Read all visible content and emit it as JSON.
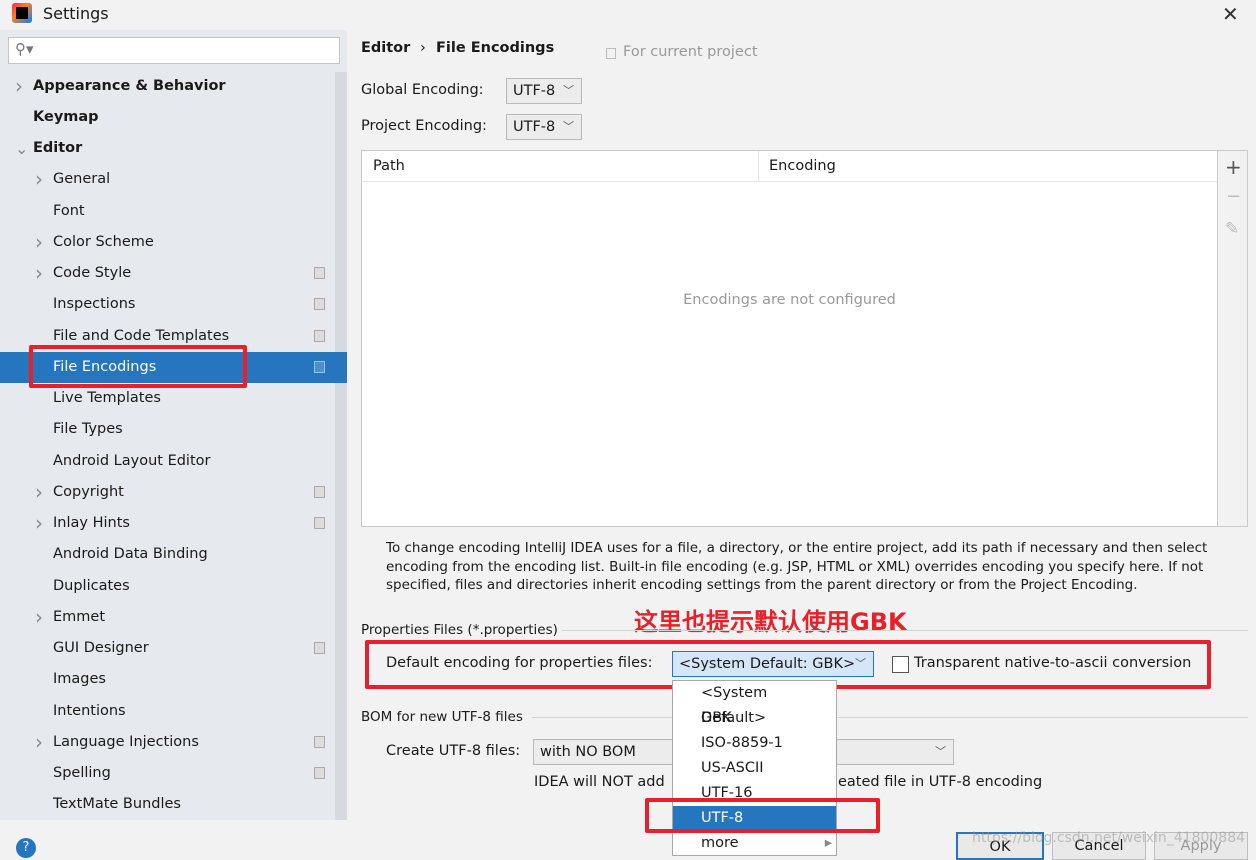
{
  "window": {
    "title": "Settings",
    "close": "✕"
  },
  "search": {
    "placeholder": "",
    "icon": "search-icon"
  },
  "sidebar": {
    "items": [
      {
        "label": "Appearance & Behavior",
        "level": 0,
        "chevron": "right",
        "bold": true,
        "copy": false
      },
      {
        "label": "Keymap",
        "level": 0,
        "chevron": "",
        "bold": true,
        "copy": false
      },
      {
        "label": "Editor",
        "level": 0,
        "chevron": "down",
        "bold": true,
        "copy": false
      },
      {
        "label": "General",
        "level": 1,
        "chevron": "right",
        "copy": false
      },
      {
        "label": "Font",
        "level": 1,
        "chevron": "",
        "copy": false
      },
      {
        "label": "Color Scheme",
        "level": 1,
        "chevron": "right",
        "copy": false
      },
      {
        "label": "Code Style",
        "level": 1,
        "chevron": "right",
        "copy": true
      },
      {
        "label": "Inspections",
        "level": 1,
        "chevron": "",
        "copy": true
      },
      {
        "label": "File and Code Templates",
        "level": 1,
        "chevron": "",
        "copy": true
      },
      {
        "label": "File Encodings",
        "level": 1,
        "chevron": "",
        "copy": true,
        "selected": true
      },
      {
        "label": "Live Templates",
        "level": 1,
        "chevron": "",
        "copy": false
      },
      {
        "label": "File Types",
        "level": 1,
        "chevron": "",
        "copy": false
      },
      {
        "label": "Android Layout Editor",
        "level": 1,
        "chevron": "",
        "copy": false
      },
      {
        "label": "Copyright",
        "level": 1,
        "chevron": "right",
        "copy": true
      },
      {
        "label": "Inlay Hints",
        "level": 1,
        "chevron": "right",
        "copy": true
      },
      {
        "label": "Android Data Binding",
        "level": 1,
        "chevron": "",
        "copy": false
      },
      {
        "label": "Duplicates",
        "level": 1,
        "chevron": "",
        "copy": false
      },
      {
        "label": "Emmet",
        "level": 1,
        "chevron": "right",
        "copy": false
      },
      {
        "label": "GUI Designer",
        "level": 1,
        "chevron": "",
        "copy": true
      },
      {
        "label": "Images",
        "level": 1,
        "chevron": "",
        "copy": false
      },
      {
        "label": "Intentions",
        "level": 1,
        "chevron": "",
        "copy": false
      },
      {
        "label": "Language Injections",
        "level": 1,
        "chevron": "right",
        "copy": true
      },
      {
        "label": "Spelling",
        "level": 1,
        "chevron": "",
        "copy": true
      },
      {
        "label": "TextMate Bundles",
        "level": 1,
        "chevron": "",
        "copy": false
      }
    ]
  },
  "breadcrumb": {
    "parent": "Editor",
    "sep": "›",
    "current": "File Encodings",
    "scope": "For current project"
  },
  "global_encoding": {
    "label": "Global Encoding:",
    "value": "UTF-8"
  },
  "project_encoding": {
    "label": "Project Encoding:",
    "value": "UTF-8"
  },
  "table": {
    "columns": [
      "Path",
      "Encoding"
    ],
    "empty": "Encodings are not configured",
    "toolbar": [
      "+",
      "−",
      "✎"
    ]
  },
  "help_text": "To change encoding IntelliJ IDEA uses for a file, a directory, or the entire project, add its path if necessary and then select encoding from the encoding list. Built-in file encoding (e.g. JSP, HTML or XML) overrides encoding you specify here. If not specified, files and directories inherit encoding settings from the parent directory or from the Project Encoding.",
  "annotation": "这里也提示默认使用GBK",
  "properties": {
    "section": "Properties Files (*.properties)",
    "label": "Default encoding for properties files:",
    "value": "<System Default: GBK>",
    "checkbox_label": "Transparent native-to-ascii conversion",
    "checked": false
  },
  "dropdown": {
    "options": [
      "<System Default>",
      "GBK",
      "ISO-8859-1",
      "US-ASCII",
      "UTF-16",
      "UTF-8",
      "more"
    ],
    "selected": "UTF-8"
  },
  "bom": {
    "section": "BOM for new UTF-8 files",
    "label": "Create UTF-8 files:",
    "value": "with NO BOM",
    "note_left": "IDEA will NOT add",
    "note_right": "eated file in UTF-8 encoding"
  },
  "buttons": {
    "ok": "OK",
    "cancel": "Cancel",
    "apply": "Apply",
    "help": "?"
  },
  "watermark": "https://blog.csdn.net/weixin_41800884",
  "colors": {
    "selection": "#2675bf",
    "highlight": "#e8202a"
  }
}
